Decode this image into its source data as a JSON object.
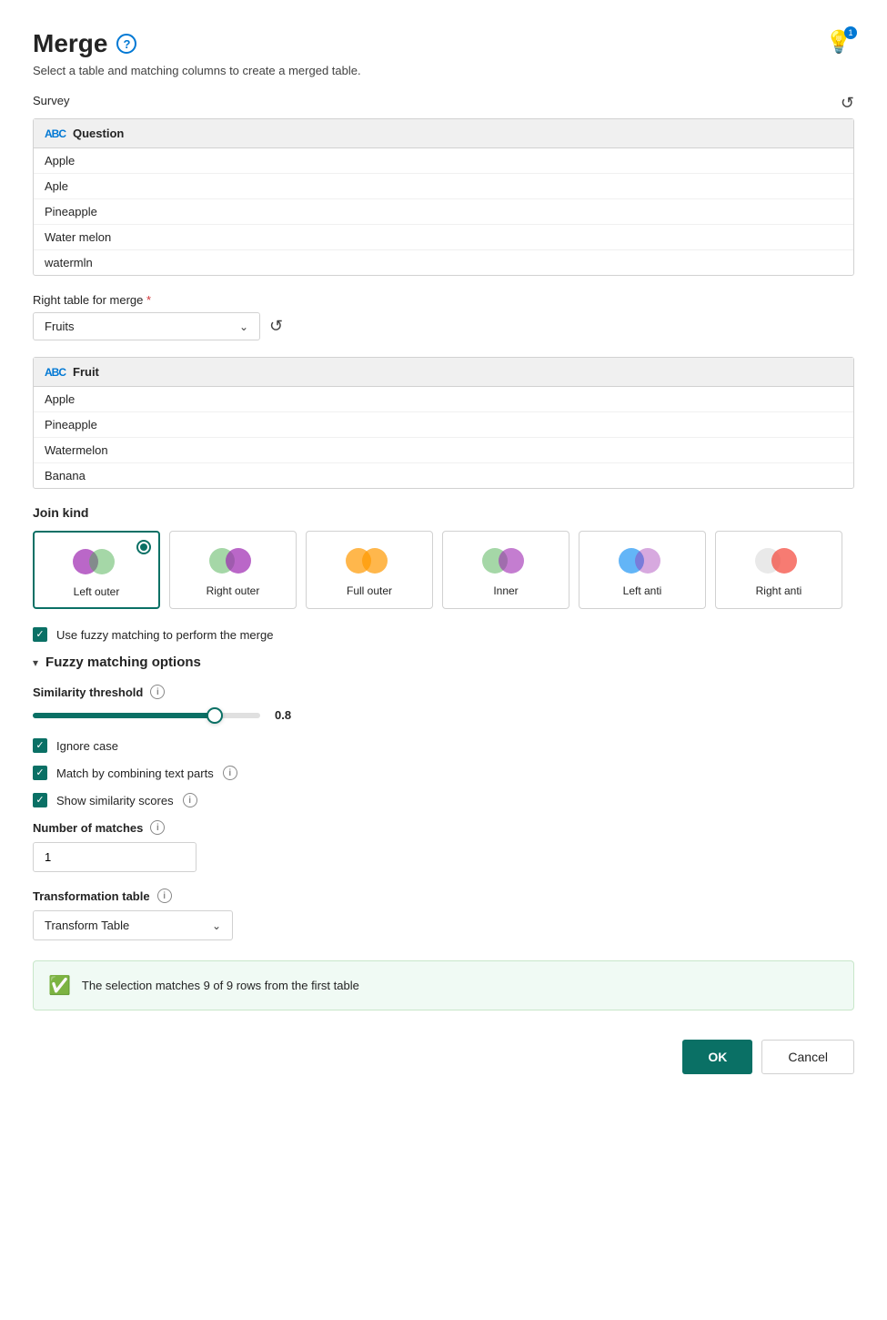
{
  "page": {
    "title": "Merge",
    "subtitle": "Select a table and matching columns to create a merged table."
  },
  "survey_table": {
    "name": "Survey",
    "column_header": "Question",
    "rows": [
      "Apple",
      "Aple",
      "Pineapple",
      "Water melon",
      "watermln"
    ]
  },
  "right_table": {
    "label": "Right table for merge",
    "required": "*",
    "selected": "Fruits"
  },
  "fruits_table": {
    "column_header": "Fruit",
    "rows": [
      "Apple",
      "Pineapple",
      "Watermelon",
      "Banana"
    ]
  },
  "join_kind": {
    "label": "Join kind",
    "options": [
      {
        "id": "left_outer",
        "label": "Left outer",
        "selected": true
      },
      {
        "id": "right_outer",
        "label": "Right outer",
        "selected": false
      },
      {
        "id": "full_outer",
        "label": "Full outer",
        "selected": false
      },
      {
        "id": "inner",
        "label": "Inner",
        "selected": false
      },
      {
        "id": "left_anti",
        "label": "Left anti",
        "selected": false
      },
      {
        "id": "right_anti",
        "label": "Right anti",
        "selected": false
      }
    ]
  },
  "fuzzy_checkbox": {
    "label": "Use fuzzy matching to perform the merge",
    "checked": true
  },
  "fuzzy_options": {
    "title": "Fuzzy matching options",
    "similarity_threshold": {
      "label": "Similarity threshold",
      "value": 0.8,
      "fill_percent": 80
    },
    "ignore_case": {
      "label": "Ignore case",
      "checked": true
    },
    "match_by_combining": {
      "label": "Match by combining text parts",
      "checked": true
    },
    "show_similarity": {
      "label": "Show similarity scores",
      "checked": true
    },
    "number_of_matches": {
      "label": "Number of matches",
      "value": "1"
    },
    "transformation_table": {
      "label": "Transformation table",
      "value": "Transform Table"
    }
  },
  "status": {
    "text": "The selection matches 9 of 9 rows from the first table"
  },
  "buttons": {
    "ok": "OK",
    "cancel": "Cancel"
  },
  "icons": {
    "help": "?",
    "bulb": "💡",
    "bulb_badge": "1",
    "refresh": "↺",
    "info": "i",
    "collapse": "▾",
    "dropdown_arrow": "⌄",
    "check": "✓",
    "circle_check": "✓"
  },
  "venn_colors": {
    "left_outer": {
      "left": "#9c27b0",
      "right": "#4caf50"
    },
    "right_outer": {
      "left": "#4caf50",
      "right": "#9c27b0"
    },
    "full_outer": {
      "left": "#ff9800",
      "right": "#ff9800"
    },
    "inner": {
      "left": "#4caf50",
      "right": "#9c27b0"
    },
    "left_anti": {
      "left": "#2196f3",
      "right": "#9c27b0"
    },
    "right_anti": {
      "left": "#e0e0e0",
      "right": "#f44336"
    }
  }
}
